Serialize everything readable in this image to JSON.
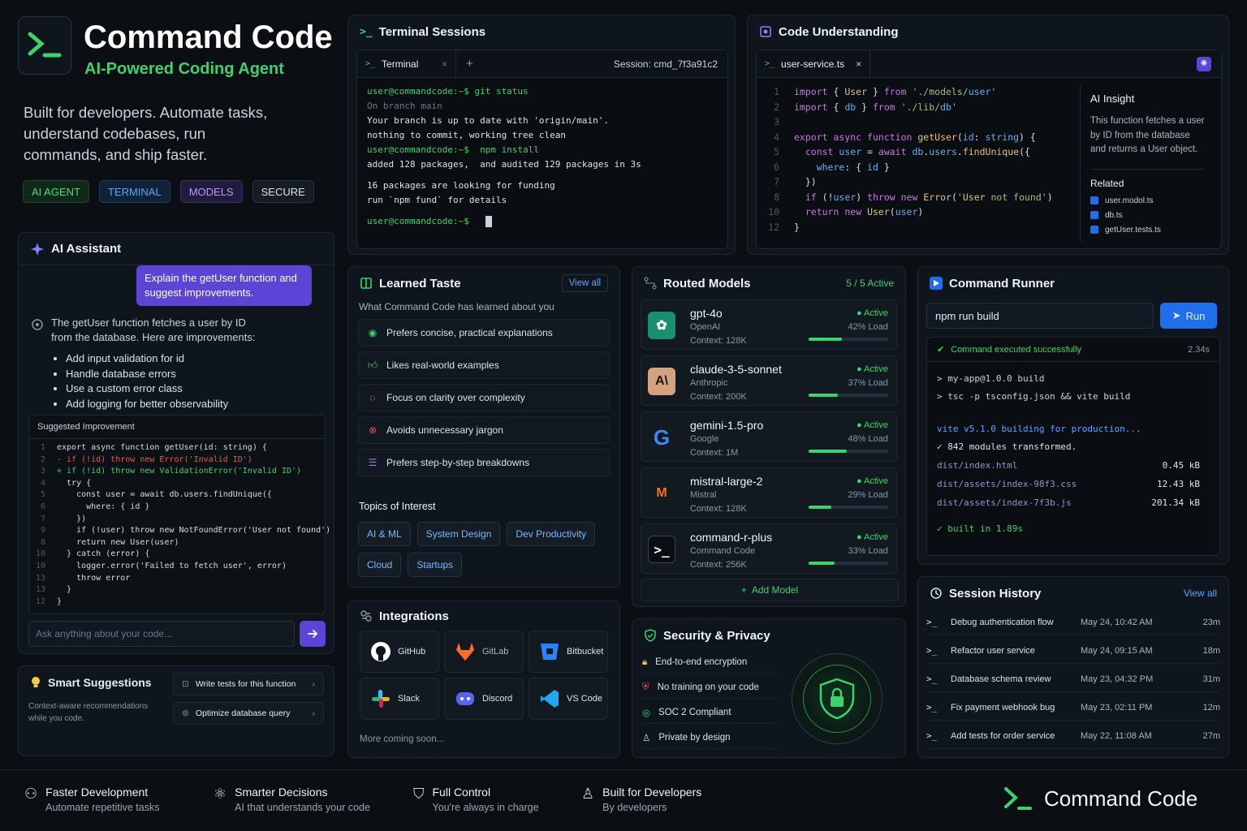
{
  "hero": {
    "title": "Command Code",
    "subtitle": "AI-Powered Coding Agent",
    "tagline": "Built for developers. Automate tasks, understand codebases, run commands, and ship faster.",
    "badges": [
      "AI AGENT",
      "TERMINAL",
      "MODELS",
      "SECURE"
    ]
  },
  "assistant": {
    "title": "AI Assistant",
    "user_message": "Explain the getUser function and suggest improvements.",
    "reply_intro": "The getUser function fetches a user by ID from the database. Here are improvements:",
    "bullets": [
      "Add input validation for id",
      "Handle database errors",
      "Use a custom error class",
      "Add logging for better observability"
    ],
    "suggested_label": "Suggested Improvement",
    "code_lines": [
      {
        "n": "1",
        "t": "export async function getUser(id: string) {"
      },
      {
        "n": "2",
        "t": "- if (!id) throw new Error('Invalid ID')"
      },
      {
        "n": "3",
        "t": "+ if (!id) throw new ValidationError('Invalid ID')"
      },
      {
        "n": "4",
        "t": "  try {"
      },
      {
        "n": "5",
        "t": "    const user = await db.users.findUnique({"
      },
      {
        "n": "6",
        "t": "      where: { id }"
      },
      {
        "n": "7",
        "t": "    })"
      },
      {
        "n": "9",
        "t": "    if (!user) throw new NotFoundError('User not found')"
      },
      {
        "n": "8",
        "t": "    return new User(user)"
      },
      {
        "n": "10",
        "t": "  } catch (error) {"
      },
      {
        "n": "10",
        "t": "    logger.error('Failed to fetch user', error)"
      },
      {
        "n": "13",
        "t": "    throw error"
      },
      {
        "n": "13",
        "t": "  }"
      },
      {
        "n": "12",
        "t": "}"
      }
    ],
    "input_placeholder": "Ask anything about your code..."
  },
  "smart": {
    "title": "Smart Suggestions",
    "desc": "Context-aware recommendations while you code.",
    "items": [
      "Write tests for this function",
      "Optimize database query"
    ]
  },
  "terminal": {
    "title": "Terminal Sessions",
    "tab": "Terminal",
    "session": "Session: cmd_7f3a91c2",
    "lines": [
      {
        "c": "g",
        "t": "user@commandcode:~$ git status"
      },
      {
        "c": "m",
        "t": "On branch main"
      },
      {
        "c": "w",
        "t": "Your branch is up to date with 'origin/main'."
      },
      {
        "c": "w",
        "t": "nothing to commit, working tree clean"
      },
      {
        "c": "g",
        "t": "user@commandcode:~$  npm install"
      },
      {
        "c": "w",
        "t": "added 128 packages,  and audited 129 packages in 3s"
      },
      {
        "c": "w",
        "t": ""
      },
      {
        "c": "w",
        "t": "16 packages are looking for funding"
      },
      {
        "c": "w",
        "t": "run `npm fund` for details"
      },
      {
        "c": "w",
        "t": ""
      },
      {
        "c": "g",
        "t": "user@commandcode:~$"
      }
    ]
  },
  "understanding": {
    "title": "Code Understanding",
    "file_tab": "user-service.ts",
    "code": [
      {
        "n": "1",
        "t": "import { User } from './models/user'"
      },
      {
        "n": "2",
        "t": "import { db } from './lib/db'"
      },
      {
        "n": "3",
        "t": ""
      },
      {
        "n": "4",
        "t": "export async function getUser(id: string) {"
      },
      {
        "n": "5",
        "t": "  const user = await db.users.findUnique({"
      },
      {
        "n": "6",
        "t": "    where: { id }"
      },
      {
        "n": "7",
        "t": "  })"
      },
      {
        "n": "8",
        "t": "  if (!user) throw new Error('User not found')"
      },
      {
        "n": "10",
        "t": "  return new User(user)"
      },
      {
        "n": "12",
        "t": "}"
      }
    ],
    "insight_title": "AI Insight",
    "insight_text": "This function fetches a user by ID from the database and returns a User object.",
    "related_label": "Related",
    "related": [
      "user.modol.ts",
      "db.ts",
      "getUser.tests.ts"
    ]
  },
  "taste": {
    "title": "Learned Taste",
    "view_all": "View all",
    "desc": "What Command Code has learned about you",
    "items": [
      "Prefers concise, practical explanations",
      "Likes real-world examples",
      "Focus on clarity over complexity",
      "Avoids unnecessary jargon",
      "Prefers step-by-step breakdowns"
    ],
    "topics_label": "Topics of Interest",
    "topics": [
      "AI & ML",
      "System Design",
      "Dev Productivity",
      "Cloud",
      "Startups"
    ]
  },
  "models": {
    "title": "Routed Models",
    "count": "5 / 5 Active",
    "list": [
      {
        "name": "gpt-4o",
        "provider": "OpenAI",
        "context": "Context: 128K",
        "status": "Active",
        "load": "42% Load",
        "load_pct": 42,
        "icon": "openai-icon"
      },
      {
        "name": "claude-3-5-sonnet",
        "provider": "Anthropic",
        "context": "Context: 200K",
        "status": "Active",
        "load": "37% Load",
        "load_pct": 37,
        "icon": "anthropic-icon"
      },
      {
        "name": "gemini-1.5-pro",
        "provider": "Google",
        "context": "Context: 1M",
        "status": "Active",
        "load": "48% Load",
        "load_pct": 48,
        "icon": "google-icon"
      },
      {
        "name": "mistral-large-2",
        "provider": "Mistral",
        "context": "Context: 128K",
        "status": "Active",
        "load": "29% Load",
        "load_pct": 29,
        "icon": "mistral-icon"
      },
      {
        "name": "command-r-plus",
        "provider": "Command Code",
        "context": "Context: 256K",
        "status": "Active",
        "load": "33% Load",
        "load_pct": 33,
        "icon": "terminal-icon"
      }
    ],
    "add": "Add Model"
  },
  "runner": {
    "title": "Command Runner",
    "input": "npm run build",
    "run": "Run",
    "success": "Command executed successfully",
    "time": "2.34s",
    "lines": [
      "> my-app@1.0.0 build",
      "> tsc -p tsconfig.json && vite build"
    ],
    "vite": "vite v5.1.0 building for production...",
    "modules": "✓ 842 modules transformed.",
    "files": [
      {
        "path": "dist/index.html",
        "size": "0.45 kB"
      },
      {
        "path": "dist/assets/index-98f3.css",
        "size": "12.43 kB"
      },
      {
        "path": "dist/assets/index-7f3b.js",
        "size": "201.34 kB"
      }
    ],
    "built": "✓ built in 1.89s"
  },
  "integrations": {
    "title": "Integrations",
    "items": [
      "GitHub",
      "GitLab",
      "Bitbucket",
      "Slack",
      "Discord",
      "VS Code"
    ],
    "more": "More coming soon..."
  },
  "security": {
    "title": "Security & Privacy",
    "items": [
      "End-to-end encryption",
      "No training on your code",
      "SOC 2 Compliant",
      "Private by design"
    ]
  },
  "history": {
    "title": "Session History",
    "view_all": "View all",
    "rows": [
      {
        "name": "Debug authentication flow",
        "date": "May 24, 10:42 AM",
        "dur": "23m"
      },
      {
        "name": "Refactor user service",
        "date": "May 24, 09:15 AM",
        "dur": "18m"
      },
      {
        "name": "Database schema review",
        "date": "May 23, 04:32 PM",
        "dur": "31m"
      },
      {
        "name": "Fix payment webhook bug",
        "date": "May 23, 02:11 PM",
        "dur": "12m"
      },
      {
        "name": "Add tests for order service",
        "date": "May 22, 11:08 AM",
        "dur": "27m"
      }
    ]
  },
  "footer": {
    "features": [
      {
        "title": "Faster Development",
        "sub": "Automate repetitive tasks"
      },
      {
        "title": "Smarter Decisions",
        "sub": "AI that understands your code"
      },
      {
        "title": "Full Control",
        "sub": "You're always in charge"
      },
      {
        "title": "Built for Developers",
        "sub": "By developers"
      }
    ],
    "brand": "Command Code"
  },
  "colors": {
    "accent_green": "#3fd16b",
    "accent_purple": "#6b4ee6",
    "accent_blue": "#1f6feb",
    "bg": "#0b0f14"
  }
}
